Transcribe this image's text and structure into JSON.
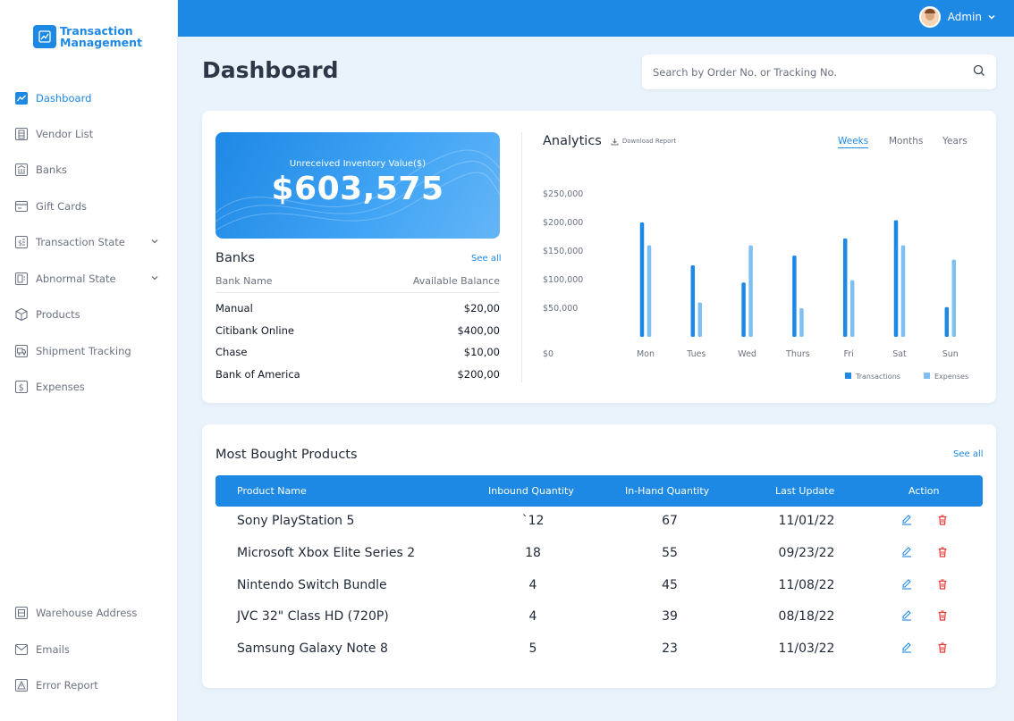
{
  "app": {
    "name_line1": "Transaction",
    "name_line2": "Management"
  },
  "user": {
    "name": "Admin"
  },
  "sidebar": {
    "items": [
      {
        "label": "Dashboard",
        "icon": "chart-line-icon"
      },
      {
        "label": "Vendor List",
        "icon": "building-icon"
      },
      {
        "label": "Banks",
        "icon": "bank-icon"
      },
      {
        "label": "Gift Cards",
        "icon": "card-icon"
      },
      {
        "label": "Transaction State",
        "icon": "transaction-icon"
      },
      {
        "label": "Abnormal State",
        "icon": "document-icon"
      },
      {
        "label": "Products",
        "icon": "box-icon"
      },
      {
        "label": "Shipment Tracking",
        "icon": "truck-icon"
      },
      {
        "label": "Expenses",
        "icon": "dollar-icon"
      }
    ],
    "bottom_items": [
      {
        "label": "Warehouse Address",
        "icon": "warehouse-icon"
      },
      {
        "label": "Emails",
        "icon": "mail-icon"
      },
      {
        "label": "Error Report",
        "icon": "warning-icon"
      }
    ]
  },
  "page": {
    "title": "Dashboard"
  },
  "search": {
    "placeholder": "Search by Order No. or Tracking No."
  },
  "inventory": {
    "label": "Unreceived Inventory Value($)",
    "value": "$603,575"
  },
  "banks": {
    "title": "Banks",
    "see_all": "See all",
    "headers": {
      "name": "Bank Name",
      "balance": "Available Balance"
    },
    "rows": [
      {
        "name": "Manual",
        "balance": "$20,00"
      },
      {
        "name": "Citibank Online",
        "balance": "$400,00"
      },
      {
        "name": "Chase",
        "balance": "$10,00"
      },
      {
        "name": "Bank of America",
        "balance": "$200,00"
      }
    ]
  },
  "analytics": {
    "title": "Analytics",
    "download_label": "Download Report",
    "tabs": [
      "Weeks",
      "Months",
      "Years"
    ],
    "active_tab": "Weeks"
  },
  "chart_data": {
    "type": "bar",
    "categories": [
      "Mon",
      "Tues",
      "Wed",
      "Thurs",
      "Fri",
      "Sat",
      "Sun"
    ],
    "y_ticks": [
      "$250,000",
      "$200,000",
      "$150,000",
      "$100,000",
      "$50,000",
      "$0"
    ],
    "ylim": [
      0,
      250000
    ],
    "series": [
      {
        "name": "Transactions",
        "color": "#1e88e5",
        "values": [
          200000,
          125000,
          95000,
          142000,
          172000,
          204000,
          52000
        ]
      },
      {
        "name": "Expenses",
        "color": "#7ec0f2",
        "values": [
          160000,
          60000,
          160000,
          50000,
          99000,
          160000,
          135000
        ]
      }
    ],
    "legend": "bottom-right"
  },
  "products": {
    "title": "Most Bought Products",
    "see_all": "See all",
    "headers": [
      "Product Name",
      "Inbound Quantity",
      "In-Hand Quantity",
      "Last Update",
      "Action"
    ],
    "rows": [
      {
        "name": "Sony PlayStation 5",
        "inbound": "`12",
        "inhand": "67",
        "updated": "11/01/22"
      },
      {
        "name": "Microsoft Xbox Elite Series 2",
        "inbound": "18",
        "inhand": "55",
        "updated": "09/23/22"
      },
      {
        "name": "Nintendo Switch Bundle",
        "inbound": "4",
        "inhand": "45",
        "updated": "11/08/22"
      },
      {
        "name": "JVC 32\" Class HD (720P)",
        "inbound": "4",
        "inhand": "39",
        "updated": "08/18/22"
      },
      {
        "name": "Samsung Galaxy Note 8",
        "inbound": "5",
        "inhand": "23",
        "updated": "11/03/22"
      }
    ]
  },
  "colors": {
    "accent": "#1e88e5",
    "accent_light": "#7ec0f2",
    "delete": "#e53935"
  }
}
